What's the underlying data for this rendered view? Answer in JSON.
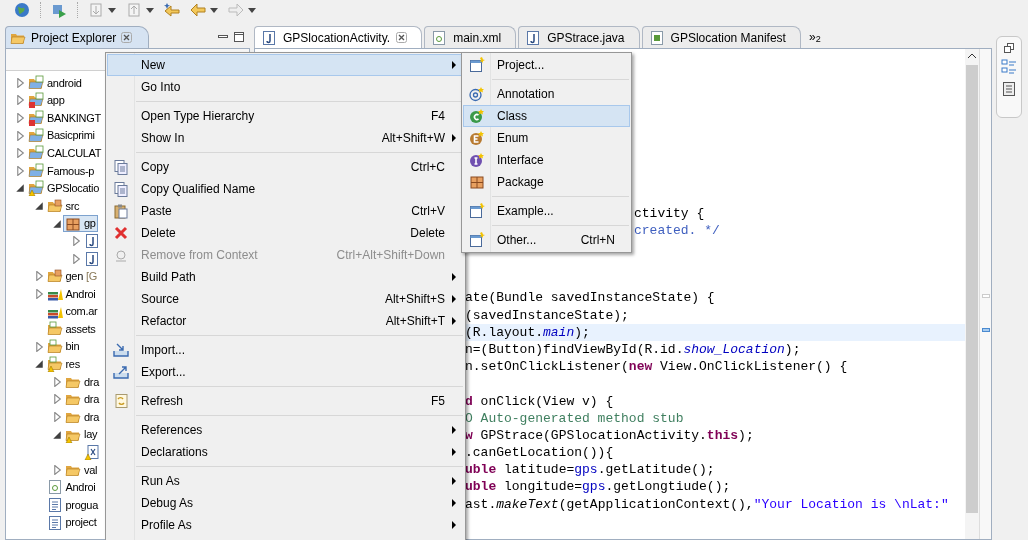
{
  "explorer": {
    "tab": {
      "label": "Project Explorer",
      "selected": true
    },
    "tree": [
      {
        "label": "android",
        "kind": "project",
        "expanded": false
      },
      {
        "label": "app",
        "kind": "project-error",
        "expanded": false
      },
      {
        "label": "BANKINGT",
        "kind": "project-error",
        "expanded": false
      },
      {
        "label": "Basicprimi",
        "kind": "project",
        "expanded": false
      },
      {
        "label": "CALCULAT",
        "kind": "project",
        "expanded": false
      },
      {
        "label": "Famous-p",
        "kind": "project",
        "expanded": false
      },
      {
        "label": "GPSlocatio",
        "kind": "project-warning",
        "expanded": true,
        "children": [
          {
            "label": "src",
            "kind": "source-folder",
            "expanded": true,
            "children": [
              {
                "label": "gp",
                "kind": "package",
                "expanded": true,
                "selected": true,
                "children": [
                  {
                    "kind": "java",
                    "expanded": false
                  },
                  {
                    "kind": "java",
                    "expanded": false
                  }
                ]
              }
            ]
          },
          {
            "label": "gen",
            "decoration": "[G",
            "kind": "source-folder",
            "expanded": false
          },
          {
            "label": "Androi",
            "kind": "library",
            "expanded": false
          },
          {
            "label": "com.ar",
            "kind": "library"
          },
          {
            "label": "assets",
            "kind": "android-folder"
          },
          {
            "label": "bin",
            "kind": "android-folder",
            "expanded": false
          },
          {
            "label": "res",
            "kind": "android-folder-warning",
            "expanded": true,
            "children": [
              {
                "label": "dra",
                "kind": "folder",
                "expanded": false
              },
              {
                "label": "dra",
                "kind": "folder",
                "expanded": false
              },
              {
                "label": "dra",
                "kind": "folder",
                "expanded": false
              },
              {
                "label": "lay",
                "kind": "folder-warning",
                "expanded": true,
                "children": [
                  {
                    "kind": "xml-warning"
                  }
                ]
              },
              {
                "label": "val",
                "kind": "folder",
                "expanded": false
              }
            ]
          },
          {
            "label": "Androi",
            "kind": "android-file"
          },
          {
            "label": "progua",
            "kind": "text-file"
          },
          {
            "label": "project",
            "kind": "text-file"
          }
        ]
      }
    ]
  },
  "editor_tabs": [
    {
      "label": "GPSlocationActivity.",
      "kind": "java",
      "selected": true
    },
    {
      "label": "main.xml",
      "kind": "android-file",
      "selected": false
    },
    {
      "label": "GPStrace.java",
      "kind": "java",
      "selected": false
    },
    {
      "label": "GPSlocation Manifest",
      "kind": "manifest",
      "selected": false
    }
  ],
  "tab_overflow": "»$_{2}$",
  "code": {
    "blocks": [
      {
        "kind": "right_of_submenu",
        "lines": [
          {
            "kind": "line",
            "current": false,
            "segments": [
              {
                "text": "ctivity {",
                "kind": "plain"
              }
            ]
          },
          {
            "kind": "line",
            "current": false,
            "segments": [
              {
                "text": "created. */",
                "kind": "javadoc"
              }
            ]
          }
        ]
      },
      {
        "kind": "right_of_menu",
        "lines": [
          {
            "kind": "line",
            "current": false,
            "segments": [
              {
                "text": "ate(Bundle savedInstanceState) {",
                "kind": "plain"
              }
            ]
          },
          {
            "kind": "line",
            "current": false,
            "segments": [
              {
                "text": "(savedInstanceState);",
                "kind": "plain"
              }
            ]
          },
          {
            "kind": "line",
            "current": true,
            "segments": [
              {
                "text": "(R.layout.",
                "kind": "plain"
              },
              {
                "text": "main",
                "kind": "static"
              },
              {
                "text": ");",
                "kind": "plain"
              }
            ]
          },
          {
            "kind": "line",
            "current": false,
            "segments": [
              {
                "text": "n=(Button)findViewById(R.id.",
                "kind": "plain"
              },
              {
                "text": "show_Location",
                "kind": "static"
              },
              {
                "text": ");",
                "kind": "plain"
              }
            ]
          },
          {
            "kind": "line",
            "current": false,
            "segments": [
              {
                "text": "n.setOnClickListener(",
                "kind": "plain"
              },
              {
                "text": "new",
                "kind": "keyword"
              },
              {
                "text": " View.OnClickListener() {",
                "kind": "plain"
              }
            ]
          },
          {
            "kind": "blank",
            "current": false
          },
          {
            "kind": "line",
            "current": false,
            "segments": [
              {
                "text": "d",
                "kind": "keyword"
              },
              {
                "text": " onClick(View v) {",
                "kind": "plain"
              }
            ]
          },
          {
            "kind": "line",
            "current": false,
            "segments": [
              {
                "text": "O Auto-generated method stub",
                "kind": "comment"
              }
            ]
          },
          {
            "kind": "line",
            "current": false,
            "segments": [
              {
                "text": "w",
                "kind": "keyword"
              },
              {
                "text": " GPStrace(GPSlocationActivity.",
                "kind": "plain"
              },
              {
                "text": "this",
                "kind": "keyword"
              },
              {
                "text": ");",
                "kind": "plain"
              }
            ]
          },
          {
            "kind": "line",
            "current": false,
            "segments": [
              {
                "text": ".canGetLocation()){",
                "kind": "plain"
              }
            ]
          },
          {
            "kind": "line",
            "current": false,
            "segments": [
              {
                "text": "uble",
                "kind": "keyword"
              },
              {
                "text": " latitude=",
                "kind": "plain"
              },
              {
                "text": "gps",
                "kind": "field"
              },
              {
                "text": ".getLatitude();",
                "kind": "plain"
              }
            ]
          },
          {
            "kind": "line",
            "current": false,
            "segments": [
              {
                "text": "uble",
                "kind": "keyword"
              },
              {
                "text": " longitude=",
                "kind": "plain"
              },
              {
                "text": "gps",
                "kind": "field"
              },
              {
                "text": ".getLongtiude();",
                "kind": "plain"
              }
            ]
          },
          {
            "kind": "line",
            "current": false,
            "segments": [
              {
                "text": "ast.",
                "kind": "plain"
              },
              {
                "text": "makeText",
                "kind": "static-plain"
              },
              {
                "text": "(getApplicationContext(),",
                "kind": "plain"
              },
              {
                "text": "\"Your Location is \\nLat:\"",
                "kind": "string"
              }
            ]
          }
        ]
      }
    ]
  },
  "context_menu": {
    "groups": [
      [
        {
          "label": "New",
          "kind": "plain",
          "submenu": true,
          "selected": true,
          "disabled": false
        },
        {
          "label": "Go Into",
          "kind": "plain",
          "submenu": false,
          "selected": false,
          "disabled": false
        }
      ],
      [
        {
          "label": "Open Type Hierarchy",
          "kind": "plain",
          "shortcut": "F4",
          "submenu": false,
          "selected": false,
          "disabled": false
        },
        {
          "label": "Show In",
          "kind": "plain",
          "shortcut": "Alt+Shift+W",
          "submenu": true,
          "selected": false,
          "disabled": false
        }
      ],
      [
        {
          "label": "Copy",
          "kind": "copy",
          "shortcut": "Ctrl+C",
          "submenu": false,
          "selected": false,
          "disabled": false
        },
        {
          "label": "Copy Qualified Name",
          "kind": "copy-qualified",
          "submenu": false,
          "selected": false,
          "disabled": false
        },
        {
          "label": "Paste",
          "kind": "paste",
          "shortcut": "Ctrl+V",
          "submenu": false,
          "selected": false,
          "disabled": false
        },
        {
          "label": "Delete",
          "kind": "delete",
          "shortcut": "Delete",
          "submenu": false,
          "selected": false,
          "disabled": false
        },
        {
          "label": "Remove from Context",
          "kind": "remove",
          "shortcut": "Ctrl+Alt+Shift+Down",
          "submenu": false,
          "selected": false,
          "disabled": true
        },
        {
          "label": "Build Path",
          "kind": "plain",
          "submenu": true,
          "selected": false,
          "disabled": false
        },
        {
          "label": "Source",
          "kind": "plain",
          "shortcut": "Alt+Shift+S",
          "submenu": true,
          "selected": false,
          "disabled": false
        },
        {
          "label": "Refactor",
          "kind": "plain",
          "shortcut": "Alt+Shift+T",
          "submenu": true,
          "selected": false,
          "disabled": false
        }
      ],
      [
        {
          "label": "Import...",
          "kind": "import",
          "submenu": false,
          "selected": false,
          "disabled": false
        },
        {
          "label": "Export...",
          "kind": "export",
          "submenu": false,
          "selected": false,
          "disabled": false
        }
      ],
      [
        {
          "label": "Refresh",
          "kind": "refresh",
          "shortcut": "F5",
          "submenu": false,
          "selected": false,
          "disabled": false
        }
      ],
      [
        {
          "label": "References",
          "kind": "plain",
          "submenu": true,
          "selected": false,
          "disabled": false
        },
        {
          "label": "Declarations",
          "kind": "plain",
          "submenu": true,
          "selected": false,
          "disabled": false
        }
      ],
      [
        {
          "label": "Run As",
          "kind": "plain",
          "submenu": true,
          "selected": false,
          "disabled": false
        },
        {
          "label": "Debug As",
          "kind": "plain",
          "submenu": true,
          "selected": false,
          "disabled": false
        },
        {
          "label": "Profile As",
          "kind": "plain",
          "submenu": true,
          "selected": false,
          "disabled": false
        }
      ]
    ]
  },
  "new_submenu": {
    "groups": [
      [
        {
          "label": "Project...",
          "kind": "new-window",
          "selected": false
        }
      ],
      [
        {
          "label": "Annotation",
          "kind": "annotation",
          "selected": false
        },
        {
          "label": "Class",
          "kind": "class",
          "selected": true
        },
        {
          "label": "Enum",
          "kind": "enum",
          "selected": false
        },
        {
          "label": "Interface",
          "kind": "interface",
          "selected": false
        },
        {
          "label": "Package",
          "kind": "package",
          "selected": false
        }
      ],
      [
        {
          "label": "Example...",
          "kind": "new-window",
          "selected": false
        }
      ],
      [
        {
          "label": "Other...",
          "kind": "new-window",
          "shortcut": "Ctrl+N",
          "selected": false
        }
      ]
    ]
  }
}
